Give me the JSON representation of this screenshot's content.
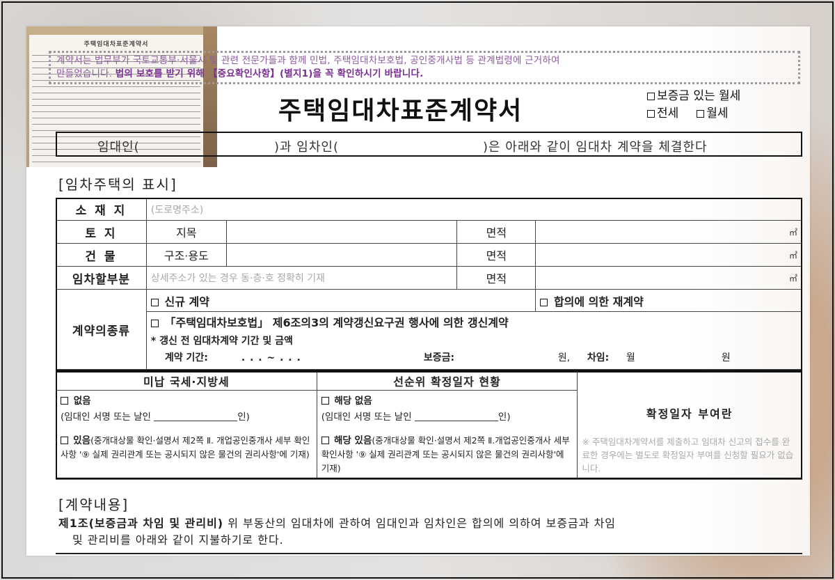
{
  "notice": {
    "line1": "계약서는 법무부가 국토교통부·서울시 및 관련 전문가들과 함께 민법, 주택임대차보호법, 공인중개사법 등 관계법령에 근거하여",
    "line2_prefix": "만들었습니다.",
    "line2_bold": "법의 보호를 받기 위해 【중요확인사항】(별지1)을 꼭 확인하시기 바랍니다."
  },
  "thumbnail": {
    "title": "주택임대차표준계약서"
  },
  "title": "주택임대차표준계약서",
  "contract_types": {
    "monthly_with_deposit": "보증금 있는 월세",
    "jeonse": "전세",
    "monthly": "월세"
  },
  "parties": {
    "landlord": "임대인(",
    "tenant": ")과 임차인(",
    "tail": ")은 아래와 같이 임대차 계약을 체결한다"
  },
  "property_section": {
    "heading": "[임차주택의 표시]",
    "address_label": "소 재 지",
    "address_placeholder": "(도로명주소)",
    "land_label": "토 지",
    "land_category": "지목",
    "area_label": "면적",
    "area_unit": "㎡",
    "building_label": "건 물",
    "building_structure": "구조·용도",
    "leased_part_label": "임차할부분",
    "leased_part_placeholder": "상세주소가 있는 경우 동·층·호 정확히 기재"
  },
  "contract_kind": {
    "label": "계약의종류",
    "new": "신규 계약",
    "renewal_agreement": "합의에 의한 재계약",
    "renewal_right": "「주택임대차보호법」 제6조의3의 계약갱신요구권 행사에 의한 갱신계약",
    "prior_note": "* 갱신 전 임대차계약 기간 및 금액",
    "period_label": "계약 기간:",
    "period_dots": ".    .    . ~    .    .    .",
    "deposit_label": "보증금:",
    "won": "원,",
    "rent_label": "차임:",
    "monthly_label": "월",
    "won2": "원"
  },
  "tax_section": {
    "header": "미납 국세·지방세",
    "none": "없음",
    "sign": "(임대인 서명 또는 날인",
    "sign_end": "인)",
    "exists": "있음",
    "exists_note": "(중개대상물 확인·설명서 제2쪽 Ⅱ. 개업공인중개사 세부 확인사항 '⑨ 실제 권리관계 또는 공시되지 않은 물건의 권리사항'에 기재)"
  },
  "priority_section": {
    "header": "선순위 확정일자 현황",
    "none": "해당 없음",
    "sign": "(임대인 서명 또는 날인",
    "sign_end": "인)",
    "exists": "해당 있음",
    "exists_note": "(중개대상물 확인·설명서 제2쪽 Ⅱ.개업공인중개사 세부 확인사항 '⑨ 실제 권리관계 또는 공시되지 않은 물건의 권리사항'에 기재)"
  },
  "confirm_section": {
    "header": "확정일자 부여란",
    "note": "※ 주택임대차계약서를 제출하고 임대차 신고의 접수를 완료한 경우에는 별도로 확정일자 부여를 신청할 필요가 없습니다."
  },
  "contents": {
    "heading": "[계약내용]",
    "article1_title": "제1조(보증금과 차임 및 관리비)",
    "article1_text": " 위 부동산의 임대차에 관하여 임대인과 임차인은 합의에 의하여 보증금과 차임",
    "article1_text2": "및 관리비를 아래와 같이 지불하기로 한다."
  }
}
